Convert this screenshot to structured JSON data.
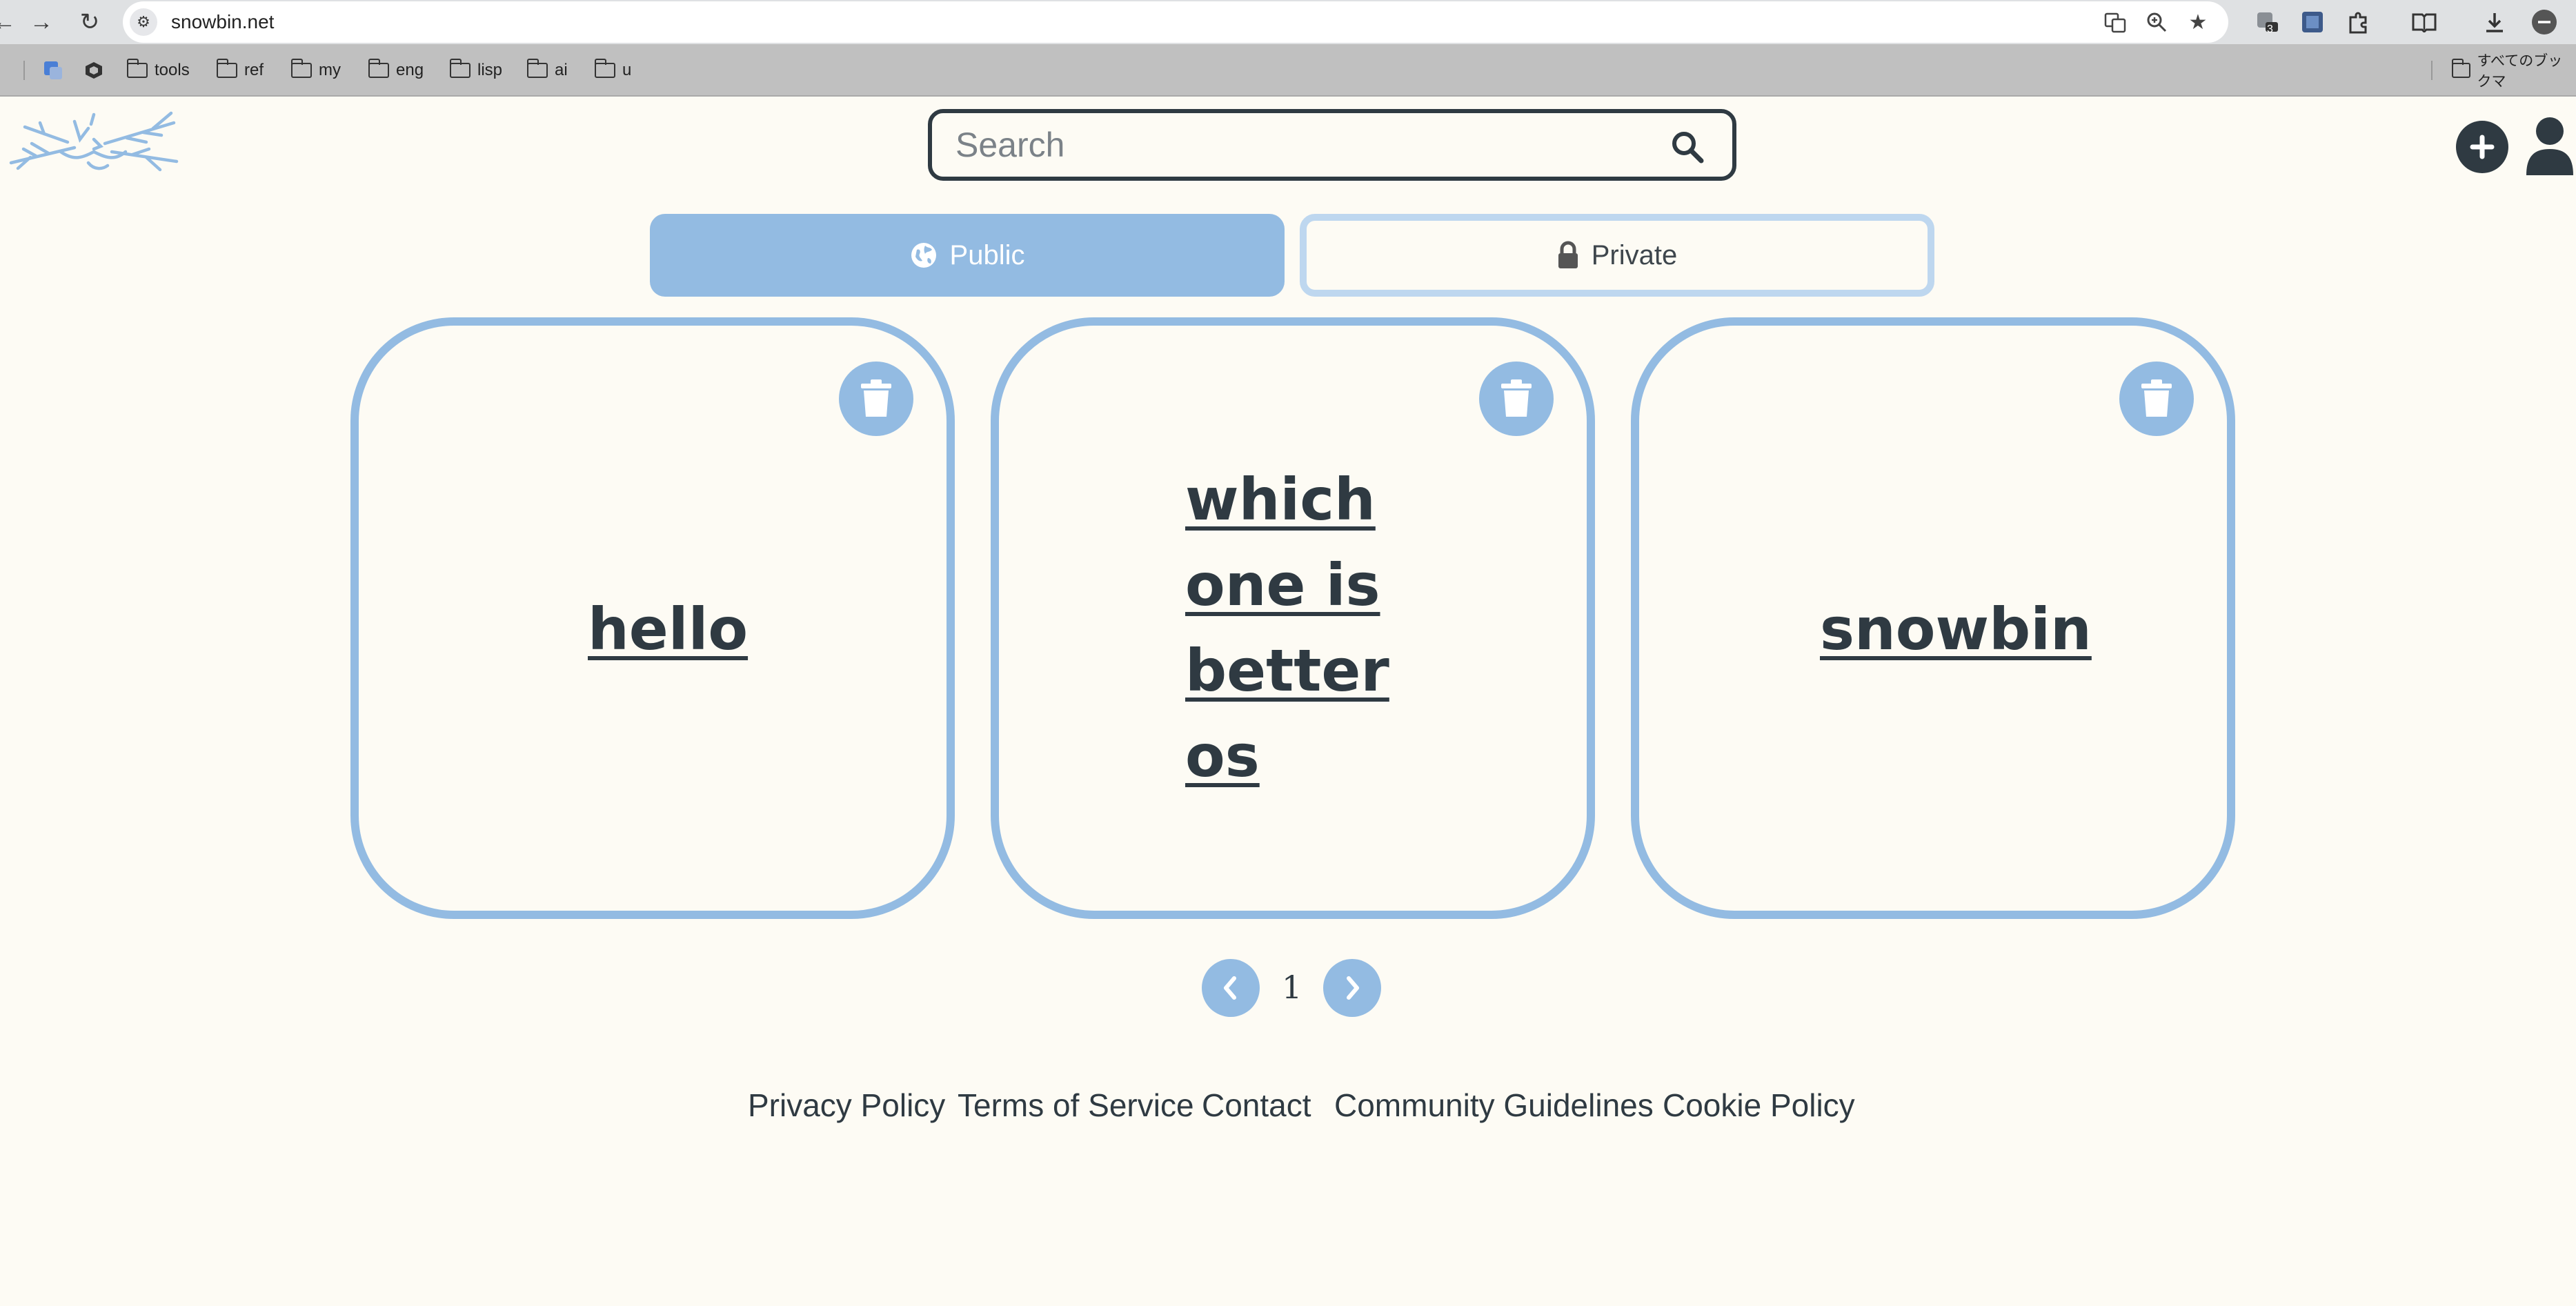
{
  "browser": {
    "url": "snowbin.net",
    "bookmarks": [
      "tools",
      "ref",
      "my",
      "eng",
      "lisp",
      "ai",
      "u"
    ],
    "other_bookmarks_label": "すべてのブックマ",
    "extension_badge": "3"
  },
  "header": {
    "search_placeholder": "Search"
  },
  "visibility_toggle": {
    "public_label": "Public",
    "private_label": "Private",
    "selected": "Public"
  },
  "cards": [
    {
      "title": "hello"
    },
    {
      "title_lines": [
        "which",
        "one is",
        "better",
        "os"
      ]
    },
    {
      "title": "snowbin"
    }
  ],
  "pagination": {
    "current_page": "1"
  },
  "footer": {
    "links": [
      "Privacy Policy",
      "Terms of Service",
      "Contact",
      "Community Guidelines",
      "Cookie Policy"
    ]
  },
  "colors": {
    "background": "#fdfbf4",
    "accent": "#93bbe2",
    "accent_light": "#bed7ef",
    "text_dark": "#2f3a42"
  }
}
